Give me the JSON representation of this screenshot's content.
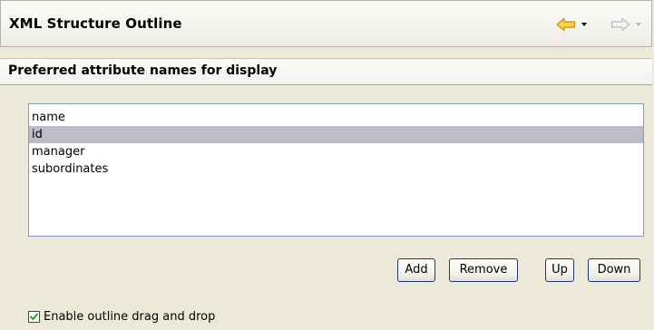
{
  "header": {
    "title": "XML Structure Outline",
    "back_icon": "back-arrow-icon",
    "forward_icon": "forward-arrow-icon"
  },
  "section": {
    "title": "Preferred attribute names for display"
  },
  "attributes": {
    "items": [
      "name",
      "id",
      "manager",
      "subordinates"
    ],
    "selected": "id"
  },
  "buttons": {
    "add": "Add",
    "remove": "Remove",
    "up": "Up",
    "down": "Down"
  },
  "options": {
    "drag_drop_label": "Enable outline drag and drop",
    "drag_drop_checked": true
  },
  "colors": {
    "back_arrow": "#f5b700",
    "selection": "#bdbdc9",
    "check": "#21a121"
  }
}
